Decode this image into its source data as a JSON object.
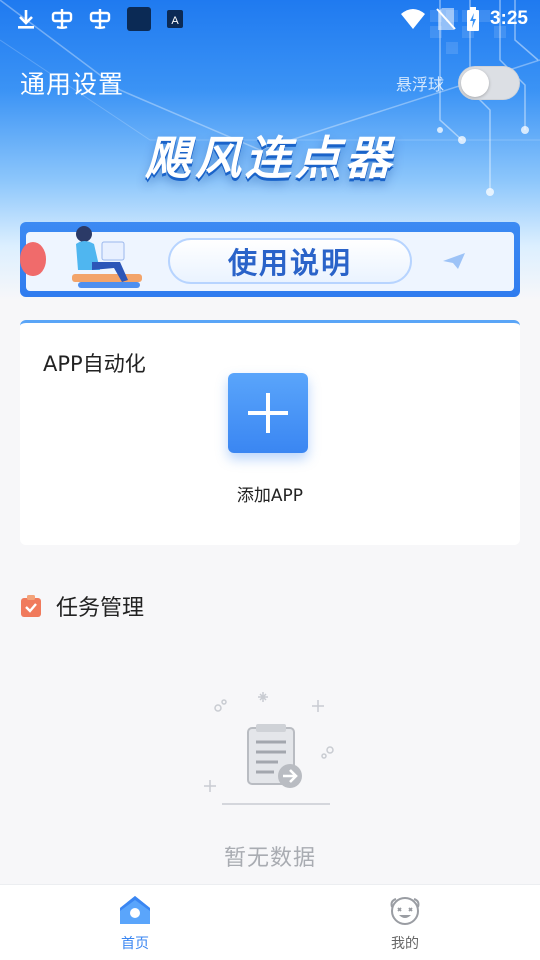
{
  "status_bar": {
    "time": "3:25",
    "icons": [
      "download-icon",
      "bug-icon",
      "bug-icon",
      "square-icon",
      "translate-a-icon",
      "wifi-icon",
      "no-sim-icon",
      "battery-charging-icon"
    ]
  },
  "header": {
    "title": "通用设置",
    "float_ball_label": "悬浮球",
    "float_ball_enabled": false,
    "brand": "飓风连点器"
  },
  "banner": {
    "text": "使用说明"
  },
  "app_section": {
    "title": "APP自动化",
    "add_label": "添加APP"
  },
  "task_section": {
    "title": "任务管理",
    "empty_text": "暂无数据"
  },
  "bottom_nav": {
    "items": [
      {
        "label": "首页",
        "icon": "home-icon",
        "active": true
      },
      {
        "label": "我的",
        "icon": "profile-face-icon",
        "active": false
      }
    ]
  },
  "colors": {
    "accent": "#3a86f2",
    "hero_top": "#1f7af0",
    "empty_text": "#a9acb2"
  }
}
